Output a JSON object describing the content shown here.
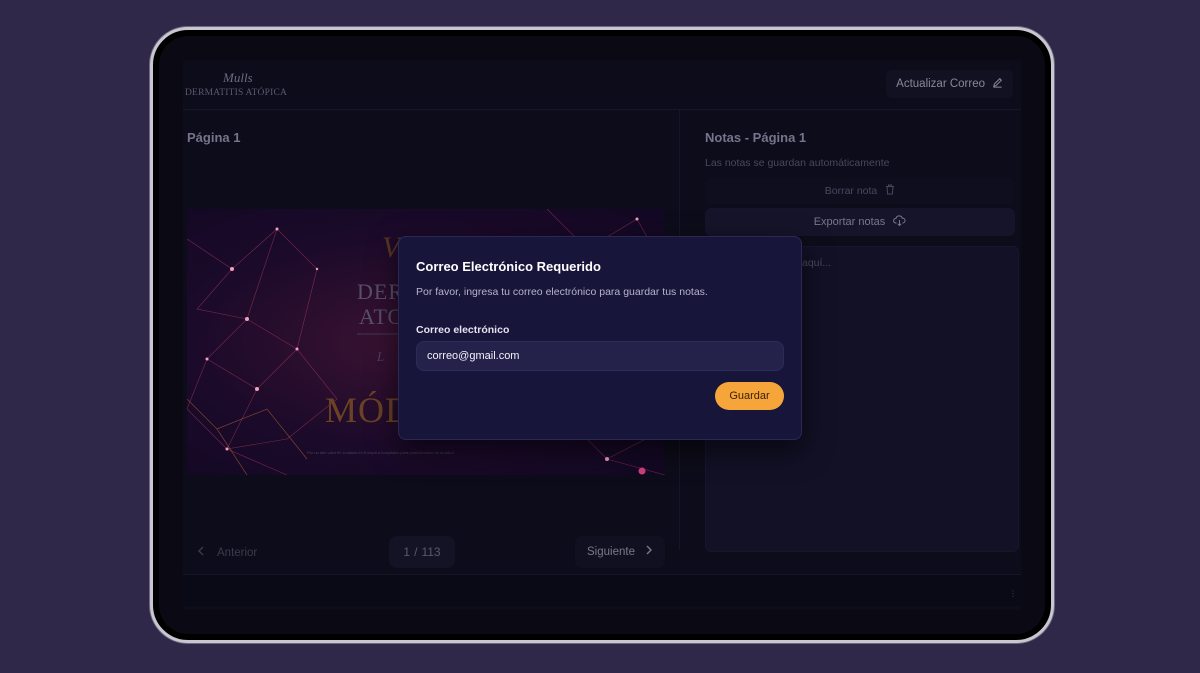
{
  "header": {
    "logo_script": "Mulls",
    "logo_text": "DERMATITIS ATÓPICA",
    "update_email_label": "Actualizar Correo"
  },
  "viewer": {
    "page_title": "Página 1",
    "slide": {
      "line1": "DER",
      "line2": "ATO",
      "line3": "MÓD",
      "caption": "Por un alto valor fin a clases en Europa a hospitales para profesionales de la salud"
    },
    "prev_label": "Anterior",
    "current_page": "1",
    "page_separator": "/",
    "total_pages": "113",
    "next_label": "Siguiente"
  },
  "notes": {
    "title": "Notas - Página 1",
    "autosave_text": "Las notas se guardan automáticamente",
    "clear_label": "Borrar nota",
    "export_label": "Exportar notas",
    "placeholder_fragment": "aquí..."
  },
  "modal": {
    "title": "Correo Electrónico Requerido",
    "description": "Por favor, ingresa tu correo electrónico para guardar tus notas.",
    "email_label": "Correo electrónico",
    "email_value": "correo@gmail.com",
    "save_label": "Guardar"
  },
  "colors": {
    "background": "#302848",
    "modal": "#17153a",
    "accent": "#f5a53a"
  },
  "icons": [
    "pencil-icon",
    "trash-icon",
    "cloud-download-icon",
    "chevron-left-icon",
    "chevron-right-icon"
  ]
}
